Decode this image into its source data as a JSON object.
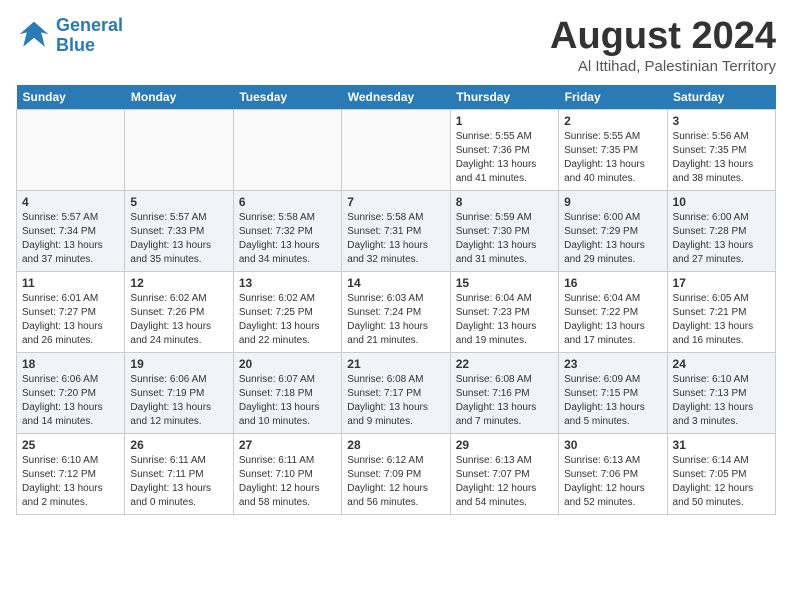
{
  "header": {
    "logo_line1": "General",
    "logo_line2": "Blue",
    "main_title": "August 2024",
    "subtitle": "Al Ittihad, Palestinian Territory"
  },
  "calendar": {
    "days_of_week": [
      "Sunday",
      "Monday",
      "Tuesday",
      "Wednesday",
      "Thursday",
      "Friday",
      "Saturday"
    ],
    "weeks": [
      [
        {
          "day": "",
          "info": ""
        },
        {
          "day": "",
          "info": ""
        },
        {
          "day": "",
          "info": ""
        },
        {
          "day": "",
          "info": ""
        },
        {
          "day": "1",
          "info": "Sunrise: 5:55 AM\nSunset: 7:36 PM\nDaylight: 13 hours\nand 41 minutes."
        },
        {
          "day": "2",
          "info": "Sunrise: 5:55 AM\nSunset: 7:35 PM\nDaylight: 13 hours\nand 40 minutes."
        },
        {
          "day": "3",
          "info": "Sunrise: 5:56 AM\nSunset: 7:35 PM\nDaylight: 13 hours\nand 38 minutes."
        }
      ],
      [
        {
          "day": "4",
          "info": "Sunrise: 5:57 AM\nSunset: 7:34 PM\nDaylight: 13 hours\nand 37 minutes."
        },
        {
          "day": "5",
          "info": "Sunrise: 5:57 AM\nSunset: 7:33 PM\nDaylight: 13 hours\nand 35 minutes."
        },
        {
          "day": "6",
          "info": "Sunrise: 5:58 AM\nSunset: 7:32 PM\nDaylight: 13 hours\nand 34 minutes."
        },
        {
          "day": "7",
          "info": "Sunrise: 5:58 AM\nSunset: 7:31 PM\nDaylight: 13 hours\nand 32 minutes."
        },
        {
          "day": "8",
          "info": "Sunrise: 5:59 AM\nSunset: 7:30 PM\nDaylight: 13 hours\nand 31 minutes."
        },
        {
          "day": "9",
          "info": "Sunrise: 6:00 AM\nSunset: 7:29 PM\nDaylight: 13 hours\nand 29 minutes."
        },
        {
          "day": "10",
          "info": "Sunrise: 6:00 AM\nSunset: 7:28 PM\nDaylight: 13 hours\nand 27 minutes."
        }
      ],
      [
        {
          "day": "11",
          "info": "Sunrise: 6:01 AM\nSunset: 7:27 PM\nDaylight: 13 hours\nand 26 minutes."
        },
        {
          "day": "12",
          "info": "Sunrise: 6:02 AM\nSunset: 7:26 PM\nDaylight: 13 hours\nand 24 minutes."
        },
        {
          "day": "13",
          "info": "Sunrise: 6:02 AM\nSunset: 7:25 PM\nDaylight: 13 hours\nand 22 minutes."
        },
        {
          "day": "14",
          "info": "Sunrise: 6:03 AM\nSunset: 7:24 PM\nDaylight: 13 hours\nand 21 minutes."
        },
        {
          "day": "15",
          "info": "Sunrise: 6:04 AM\nSunset: 7:23 PM\nDaylight: 13 hours\nand 19 minutes."
        },
        {
          "day": "16",
          "info": "Sunrise: 6:04 AM\nSunset: 7:22 PM\nDaylight: 13 hours\nand 17 minutes."
        },
        {
          "day": "17",
          "info": "Sunrise: 6:05 AM\nSunset: 7:21 PM\nDaylight: 13 hours\nand 16 minutes."
        }
      ],
      [
        {
          "day": "18",
          "info": "Sunrise: 6:06 AM\nSunset: 7:20 PM\nDaylight: 13 hours\nand 14 minutes."
        },
        {
          "day": "19",
          "info": "Sunrise: 6:06 AM\nSunset: 7:19 PM\nDaylight: 13 hours\nand 12 minutes."
        },
        {
          "day": "20",
          "info": "Sunrise: 6:07 AM\nSunset: 7:18 PM\nDaylight: 13 hours\nand 10 minutes."
        },
        {
          "day": "21",
          "info": "Sunrise: 6:08 AM\nSunset: 7:17 PM\nDaylight: 13 hours\nand 9 minutes."
        },
        {
          "day": "22",
          "info": "Sunrise: 6:08 AM\nSunset: 7:16 PM\nDaylight: 13 hours\nand 7 minutes."
        },
        {
          "day": "23",
          "info": "Sunrise: 6:09 AM\nSunset: 7:15 PM\nDaylight: 13 hours\nand 5 minutes."
        },
        {
          "day": "24",
          "info": "Sunrise: 6:10 AM\nSunset: 7:13 PM\nDaylight: 13 hours\nand 3 minutes."
        }
      ],
      [
        {
          "day": "25",
          "info": "Sunrise: 6:10 AM\nSunset: 7:12 PM\nDaylight: 13 hours\nand 2 minutes."
        },
        {
          "day": "26",
          "info": "Sunrise: 6:11 AM\nSunset: 7:11 PM\nDaylight: 13 hours\nand 0 minutes."
        },
        {
          "day": "27",
          "info": "Sunrise: 6:11 AM\nSunset: 7:10 PM\nDaylight: 12 hours\nand 58 minutes."
        },
        {
          "day": "28",
          "info": "Sunrise: 6:12 AM\nSunset: 7:09 PM\nDaylight: 12 hours\nand 56 minutes."
        },
        {
          "day": "29",
          "info": "Sunrise: 6:13 AM\nSunset: 7:07 PM\nDaylight: 12 hours\nand 54 minutes."
        },
        {
          "day": "30",
          "info": "Sunrise: 6:13 AM\nSunset: 7:06 PM\nDaylight: 12 hours\nand 52 minutes."
        },
        {
          "day": "31",
          "info": "Sunrise: 6:14 AM\nSunset: 7:05 PM\nDaylight: 12 hours\nand 50 minutes."
        }
      ]
    ]
  }
}
